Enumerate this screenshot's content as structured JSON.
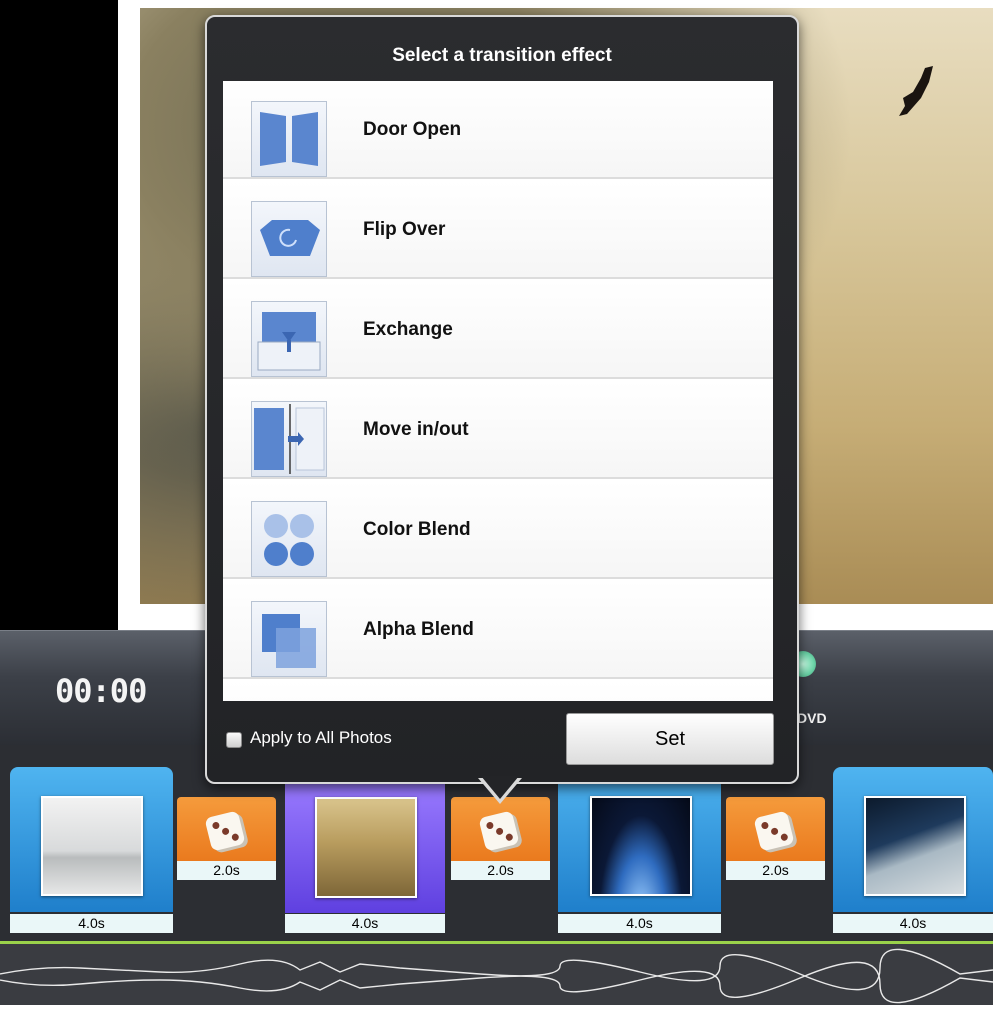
{
  "popover": {
    "title": "Select a transition effect",
    "effects": [
      {
        "label": "Door Open",
        "icon": "door-open-icon"
      },
      {
        "label": "Flip Over",
        "icon": "flip-over-icon"
      },
      {
        "label": "Exchange",
        "icon": "exchange-icon"
      },
      {
        "label": "Move in/out",
        "icon": "move-in-out-icon"
      },
      {
        "label": "Color Blend",
        "icon": "color-blend-icon"
      },
      {
        "label": "Alpha Blend",
        "icon": "alpha-blend-icon"
      }
    ],
    "apply_all_label": "Apply to All Photos",
    "apply_all_checked": false,
    "set_label": "Set"
  },
  "player": {
    "timer": "00:00",
    "dvd_label": "DVD"
  },
  "timeline": {
    "photos": [
      {
        "duration": "4.0s",
        "selected": false
      },
      {
        "duration": "4.0s",
        "selected": true
      },
      {
        "duration": "4.0s",
        "selected": false
      },
      {
        "duration": "4.0s",
        "selected": false
      }
    ],
    "transitions": [
      {
        "duration": "2.0s",
        "icon": "dice-icon"
      },
      {
        "duration": "2.0s",
        "icon": "dice-icon"
      },
      {
        "duration": "2.0s",
        "icon": "dice-icon"
      }
    ]
  },
  "colors": {
    "photo_clip": "#1f7fcb",
    "selected_clip": "#6a4cf0",
    "transition_clip": "#ea7a1e",
    "audio_line": "#9ad24a"
  }
}
